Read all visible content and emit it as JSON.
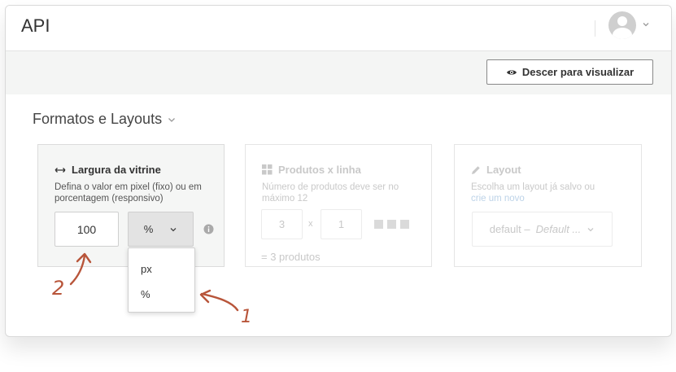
{
  "header": {
    "title": "API",
    "avatar_icon": "user-avatar-icon"
  },
  "toolbar": {
    "scroll_button_label": "Descer para visualizar",
    "scroll_button_icon": "eye-icon"
  },
  "section": {
    "title": "Formatos e Layouts"
  },
  "cards": {
    "width": {
      "title": "Largura da vitrine",
      "icon": "horizontal-arrows-icon",
      "description": "Defina o valor em pixel (fixo) ou em porcentagem (responsivo)",
      "value": "100",
      "unit_selected": "%",
      "unit_options": [
        "px",
        "%"
      ]
    },
    "products": {
      "title": "Produtos x linha",
      "icon": "grid-icon",
      "description": "Número de produtos deve ser no máximo 12",
      "rows": "3",
      "separator": "x",
      "cols": "1",
      "summary": "= 3 produtos"
    },
    "layout": {
      "title": "Layout",
      "icon": "pencil-icon",
      "description": "Escolha um layout já salvo ou",
      "link_text": "crie um novo",
      "selected_prefix": "default –",
      "selected_name": "Default ..."
    }
  },
  "annotations": {
    "one": "1",
    "two": "2"
  },
  "colors": {
    "annotation": "#b8553a",
    "card_active_bg": "#f5f6f5",
    "toolbar_bg": "#f4f5f4"
  }
}
